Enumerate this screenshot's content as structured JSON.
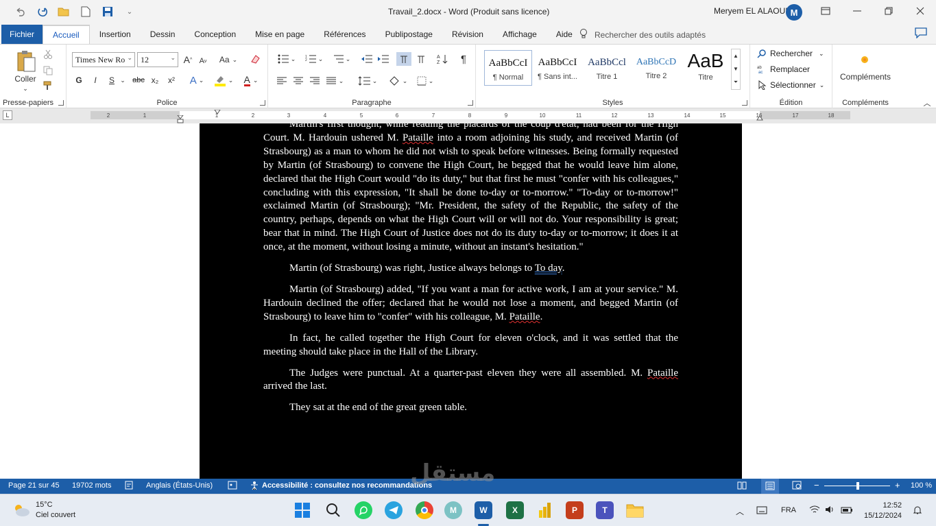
{
  "titlebar": {
    "doc_title": "Travail_2.docx  -  Word (Produit sans licence)",
    "user_name": "Meryem EL ALAOUI",
    "user_initial": "M"
  },
  "tabs": [
    "Fichier",
    "Accueil",
    "Insertion",
    "Dessin",
    "Conception",
    "Mise en page",
    "Références",
    "Publipostage",
    "Révision",
    "Affichage",
    "Aide"
  ],
  "search_tools": "Rechercher des outils adaptés",
  "ribbon": {
    "clipboard": {
      "paste": "Coller",
      "label": "Presse-papiers"
    },
    "font": {
      "name": "Times New Ro",
      "size": "12",
      "label": "Police",
      "bold": "G",
      "italic": "I",
      "underline": "S",
      "strike": "abc",
      "sub": "x₂",
      "sup": "x²",
      "case": "Aa",
      "grow": "A",
      "shrink": "A"
    },
    "paragraph": {
      "label": "Paragraphe",
      "pilcrow": "¶"
    },
    "styles": {
      "label": "Styles",
      "items": [
        {
          "preview": "AaBbCcI",
          "name": "¶ Normal"
        },
        {
          "preview": "AaBbCcI",
          "name": "¶ Sans int..."
        },
        {
          "preview": "AaBbCcl",
          "name": "Titre 1"
        },
        {
          "preview": "AaBbCcD",
          "name": "Titre 2"
        },
        {
          "preview": "AaB",
          "name": "Titre"
        }
      ]
    },
    "editing": {
      "find": "Rechercher",
      "replace": "Remplacer",
      "select": "Sélectionner",
      "label": "Édition"
    },
    "addins": {
      "name": "Compléments",
      "label": "Compléments"
    }
  },
  "ruler_ticks": [
    "2",
    "1",
    "1",
    "2",
    "3",
    "4",
    "5",
    "6",
    "7",
    "8",
    "9",
    "10",
    "11",
    "12",
    "13",
    "14",
    "15",
    "16",
    "17",
    "18"
  ],
  "document": {
    "p1_a": "Martin's first thought, while reading the placards of the coup d'état, had been for the High Court. M. Hardouin ushered M. ",
    "p1_word": "Pataille",
    "p1_b": " into a room adjoining his study, and received Martin (of Strasbourg) as a man to whom he did not wish to speak before witnesses. Being formally requested by Martin (of Strasbourg) to convene the High Court, he begged that he would leave him alone, declared that the High Court would \"do its duty,\" but that first he must \"confer with his colleagues,\" concluding with this expression, \"It shall be done to-day or to-morrow.\" \"To-day or to-morrow!\" exclaimed Martin (of Strasbourg); \"Mr. President, the safety of the Republic, the safety of the country, perhaps, depends on what the High Court will or will not do. Your responsibility is great; bear that in mind. The High Court of Justice does not do its duty to-day or to-morrow; it does it at once, at the moment, without losing a minute, without an instant's hesitation.\"",
    "p2_a": "Martin (of Strasbourg) was right, Justice always belongs to ",
    "p2_word": "To day",
    "p2_b": ".",
    "p3_a": "Martin (of Strasbourg) added, \"If you want a man for active work, I am at your service.\" M. Hardouin declined the offer; declared that he would not lose a moment, and begged Martin (of Strasbourg) to leave him to \"confer\" with his colleague, M. ",
    "p3_word": "Pataille",
    "p3_b": ".",
    "p4": "In fact, he called together the High Court for eleven o'clock, and it was settled that the meeting should take place in the Hall of the Library.",
    "p5_a": "The Judges were punctual. At a quarter-past eleven they were all assembled. M. ",
    "p5_word": "Pataille",
    "p5_b": " arrived the last.",
    "p6": "They sat at the end of the great green table."
  },
  "statusbar": {
    "page": "Page 21 sur 45",
    "words": "19702 mots",
    "language": "Anglais (États-Unis)",
    "accessibility": "Accessibilité : consultez nos recommandations",
    "zoom": "100 %"
  },
  "taskbar": {
    "temp": "15°C",
    "weather": "Ciel couvert",
    "lang": "FRA",
    "time": "12:52",
    "date": "15/12/2024"
  },
  "watermark": "مستقل"
}
